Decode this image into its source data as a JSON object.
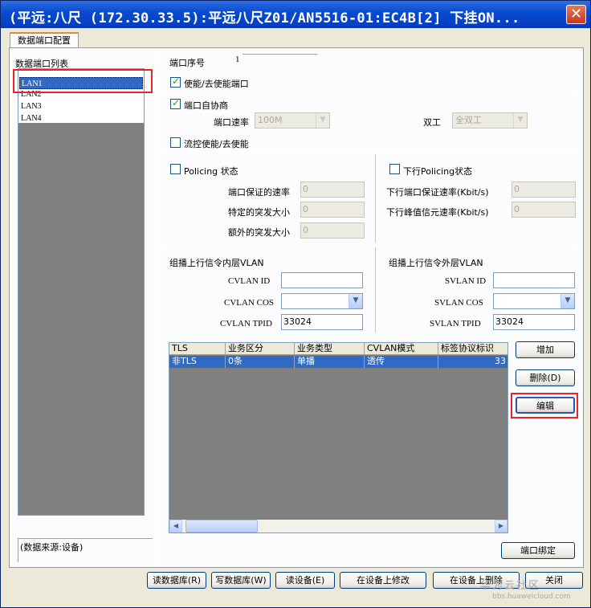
{
  "window": {
    "title": "(平远:八尺 (172.30.33.5):平远八尺Z01/AN5516-01:EC4B[2] 下挂ON...",
    "close_glyph": "✕"
  },
  "tab": {
    "label": "数据端口配置"
  },
  "port_list": {
    "header": "数据端口列表",
    "items": [
      "LAN1",
      "LAN2",
      "LAN3",
      "LAN4"
    ],
    "selected": "LAN1"
  },
  "status": "(数据来源:设备)",
  "port_config": {
    "port_no_label": "端口序号",
    "port_no_value": "1",
    "enable_label": "使能/去使能端口",
    "enable_checked": true,
    "autoneg_label": "端口自协商",
    "autoneg_checked": true,
    "speed_label": "端口速率",
    "speed_value": "100M",
    "duplex_label": "双工",
    "duplex_value": "全双工",
    "flow_label": "流控使能/去使能",
    "flow_checked": false
  },
  "policing": {
    "up_label": "Policing 状态",
    "up_fields": [
      {
        "label": "端口保证的速率",
        "value": "0"
      },
      {
        "label": "特定的突发大小",
        "value": "0"
      },
      {
        "label": "额外的突发大小",
        "value": "0"
      }
    ],
    "down_label": "下行Policing状态",
    "down_fields": [
      {
        "label": "下行端口保证速率(Kbit/s)",
        "value": "0"
      },
      {
        "label": "下行峰值信元速率(Kbit/s)",
        "value": "0"
      }
    ]
  },
  "multicast": {
    "inner_title": "组播上行信令内层VLAN",
    "inner_id_label": "CVLAN ID",
    "inner_id_value": "",
    "inner_cos_label": "CVLAN COS",
    "inner_cos_value": "",
    "inner_tpid_label": "CVLAN TPID",
    "inner_tpid_value": "33024",
    "outer_title": "组播上行信令外层VLAN",
    "outer_id_label": "SVLAN ID",
    "outer_id_value": "",
    "outer_cos_label": "SVLAN COS",
    "outer_cos_value": "",
    "outer_tpid_label": "SVLAN TPID",
    "outer_tpid_value": "33024"
  },
  "table": {
    "columns": [
      "TLS",
      "业务区分",
      "业务类型",
      "CVLAN模式",
      "标签协议标识"
    ],
    "rows": [
      [
        "非TLS",
        "0条",
        "单播",
        "透传",
        "33"
      ]
    ]
  },
  "side_buttons": {
    "add": "增加",
    "delete": "删除(D)",
    "edit": "编辑",
    "bind": "端口绑定"
  },
  "bottom_buttons": {
    "read_db": "读数据库(R)",
    "write_db": "写数据库(W)",
    "read_dev": "读设备(E)",
    "modify_dev": "在设备上修改",
    "delete_dev": "在设备上删除",
    "close": "关闭"
  },
  "watermark": {
    "line1": "华为云社区",
    "line2": "bbs.huaweicloud.com"
  },
  "colors": {
    "title_blue": "#0a4bd0",
    "selection": "#316ac5",
    "highlight_red": "#e8242b",
    "face": "#ece9d8"
  }
}
